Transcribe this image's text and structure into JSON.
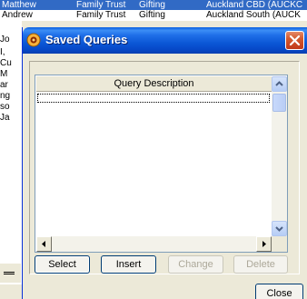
{
  "background_grid": {
    "selected_row": [
      "Matthew",
      "Family Trust",
      "Gifting",
      "Auckland CBD (AUCKC"
    ],
    "second_row": [
      "Andrew",
      "Family Trust",
      "Gifting",
      "Auckland South (AUCK"
    ],
    "left_fragments": [
      "Jo",
      "I,",
      "Cu",
      "M",
      "ar",
      "ng",
      "so",
      "Ja"
    ]
  },
  "dialog": {
    "title": "Saved Queries",
    "list": {
      "column_header": "Query Description",
      "rows": []
    },
    "buttons": {
      "select": "Select",
      "insert": "Insert",
      "change": "Change",
      "delete": "Delete",
      "close": "Close"
    }
  },
  "colors": {
    "titlebar": "#0b57d6",
    "selection": "#316ac5",
    "face": "#ece9d8"
  }
}
